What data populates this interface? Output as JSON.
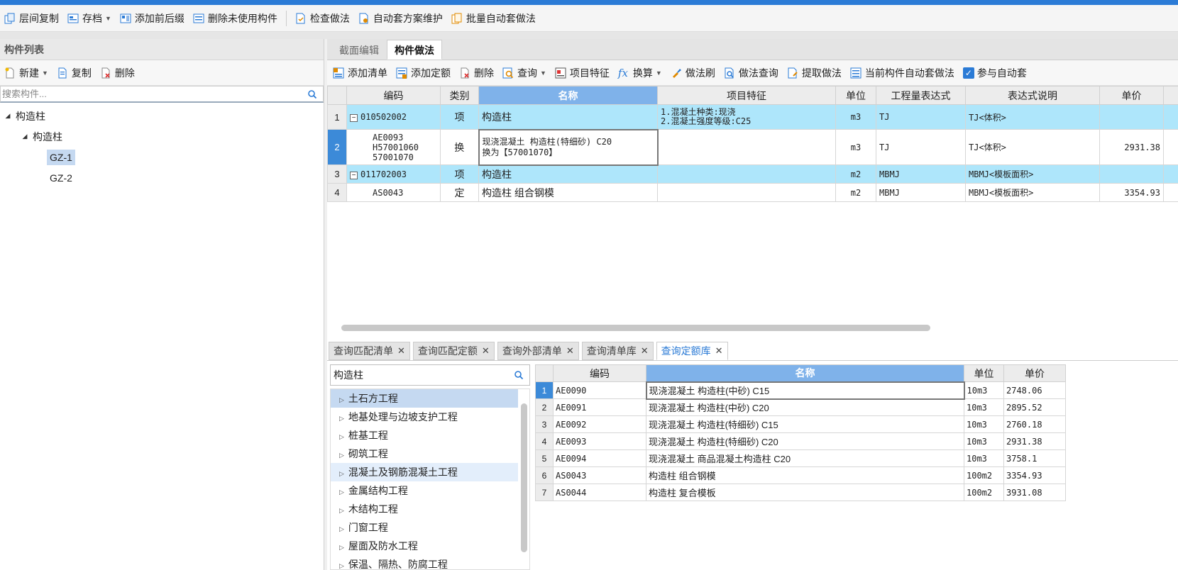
{
  "colors": {
    "accent": "#2b7bd6",
    "row_highlight": "#aee6fb",
    "header_highlight": "#7fb2ea"
  },
  "toolbar": [
    {
      "label": "层间复制",
      "icon": "copy-floor-icon"
    },
    {
      "label": "存档",
      "icon": "archive-icon",
      "dropdown": true
    },
    {
      "label": "添加前后缀",
      "icon": "add-prefix-icon"
    },
    {
      "label": "删除未使用构件",
      "icon": "delete-unused-icon"
    },
    {
      "label": "检查做法",
      "icon": "check-method-icon"
    },
    {
      "label": "自动套方案维护",
      "icon": "auto-scheme-icon"
    },
    {
      "label": "批量自动套做法",
      "icon": "batch-auto-icon"
    }
  ],
  "left": {
    "title": "构件列表",
    "toolbar": {
      "new": "新建",
      "copy": "复制",
      "delete": "删除"
    },
    "search_placeholder": "搜索构件...",
    "tree": {
      "root": "构造柱",
      "child": "构造柱",
      "leaves": [
        "GZ-1",
        "GZ-2"
      ]
    }
  },
  "right": {
    "tabs": [
      "截面编辑",
      "构件做法"
    ],
    "toolbar": {
      "add_list": "添加清单",
      "add_quota": "添加定额",
      "delete": "删除",
      "query": "查询",
      "feature": "项目特征",
      "convert": "换算",
      "brush": "做法刷",
      "method_query": "做法查询",
      "extract": "提取做法",
      "current_auto": "当前构件自动套做法",
      "join_auto": "参与自动套"
    },
    "grid": {
      "headers": [
        "编码",
        "类别",
        "名称",
        "项目特征",
        "单位",
        "工程量表达式",
        "表达式说明",
        "单价"
      ],
      "rows": [
        {
          "no": "1",
          "code": "010502002",
          "type": "项",
          "name": "构造柱",
          "feature1": "1.混凝土种类:现浇",
          "feature2": "2.混凝土强度等级:C25",
          "unit": "m3",
          "expr": "TJ",
          "desc": "TJ<体积>",
          "price": ""
        },
        {
          "no": "2",
          "code1": "AE0093",
          "code2": "H57001060",
          "code3": "57001070",
          "type": "换",
          "name1": "现浇混凝土 构造柱(特细砂) C20",
          "name2": "换为【57001070】",
          "unit": "m3",
          "expr": "TJ",
          "desc": "TJ<体积>",
          "price": "2931.38"
        },
        {
          "no": "3",
          "code": "011702003",
          "type": "项",
          "name": "构造柱",
          "unit": "m2",
          "expr": "MBMJ",
          "desc": "MBMJ<模板面积>",
          "price": ""
        },
        {
          "no": "4",
          "code": "AS0043",
          "type": "定",
          "name": "构造柱 组合钢模",
          "unit": "m2",
          "expr": "MBMJ",
          "desc": "MBMJ<模板面积>",
          "price": "3354.93"
        }
      ]
    }
  },
  "bottom": {
    "tabs": [
      "查询匹配清单",
      "查询匹配定额",
      "查询外部清单",
      "查询清单库",
      "查询定额库"
    ],
    "search_value": "构造柱",
    "categories": [
      "土石方工程",
      "地基处理与边坡支护工程",
      "桩基工程",
      "砌筑工程",
      "混凝土及钢筋混凝土工程",
      "金属结构工程",
      "木结构工程",
      "门窗工程",
      "屋面及防水工程",
      "保温、隔热、防腐工程"
    ],
    "grid": {
      "headers": [
        "编码",
        "名称",
        "单位",
        "单价"
      ],
      "rows": [
        {
          "no": "1",
          "code": "AE0090",
          "name": "现浇混凝土 构造柱(中砂) C15",
          "unit": "10m3",
          "price": "2748.06"
        },
        {
          "no": "2",
          "code": "AE0091",
          "name": "现浇混凝土 构造柱(中砂) C20",
          "unit": "10m3",
          "price": "2895.52"
        },
        {
          "no": "3",
          "code": "AE0092",
          "name": "现浇混凝土 构造柱(特细砂) C15",
          "unit": "10m3",
          "price": "2760.18"
        },
        {
          "no": "4",
          "code": "AE0093",
          "name": "现浇混凝土 构造柱(特细砂) C20",
          "unit": "10m3",
          "price": "2931.38"
        },
        {
          "no": "5",
          "code": "AE0094",
          "name": "现浇混凝土 商品混凝土构造柱 C20",
          "unit": "10m3",
          "price": "3758.1"
        },
        {
          "no": "6",
          "code": "AS0043",
          "name": "构造柱 组合钢模",
          "unit": "100m2",
          "price": "3354.93"
        },
        {
          "no": "7",
          "code": "AS0044",
          "name": "构造柱 复合模板",
          "unit": "100m2",
          "price": "3931.08"
        }
      ]
    }
  }
}
